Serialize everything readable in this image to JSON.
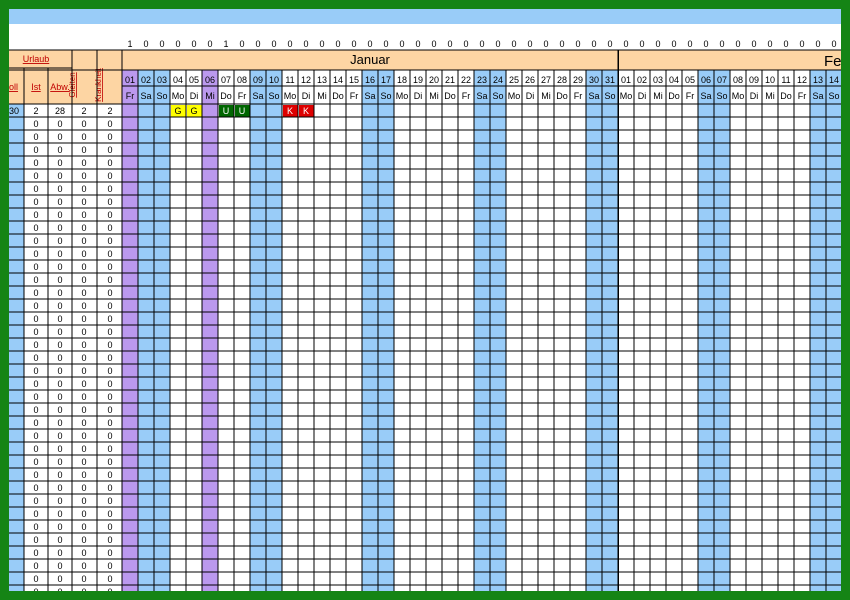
{
  "header": {
    "urlaub": "Urlaub",
    "soll": "oll",
    "ist": "Ist",
    "abw": "Abw.",
    "gleitzeit": "Gleiten",
    "krankheit": "Krankheit"
  },
  "months": [
    {
      "label": "Januar"
    },
    {
      "label": "Fe"
    }
  ],
  "flag_row": [
    "1",
    "0",
    "0",
    "0",
    "0",
    "0",
    "1",
    "0",
    "0",
    "0",
    "0",
    "0",
    "0",
    "0",
    "0",
    "0",
    "0",
    "0",
    "0",
    "0",
    "0",
    "0",
    "0",
    "0",
    "0",
    "0",
    "0",
    "0",
    "0",
    "0",
    "0",
    "0",
    "0",
    "0",
    "0",
    "0",
    "0",
    "0",
    "0",
    "0",
    "0",
    "0",
    "0",
    "0",
    "0"
  ],
  "days": [
    {
      "n": "01",
      "d": "Fr",
      "t": "holiday"
    },
    {
      "n": "02",
      "d": "Sa",
      "t": "weekend"
    },
    {
      "n": "03",
      "d": "So",
      "t": "weekend"
    },
    {
      "n": "04",
      "d": "Mo",
      "t": "work"
    },
    {
      "n": "05",
      "d": "Di",
      "t": "work"
    },
    {
      "n": "06",
      "d": "Mi",
      "t": "holiday"
    },
    {
      "n": "07",
      "d": "Do",
      "t": "work"
    },
    {
      "n": "08",
      "d": "Fr",
      "t": "work"
    },
    {
      "n": "09",
      "d": "Sa",
      "t": "weekend"
    },
    {
      "n": "10",
      "d": "So",
      "t": "weekend"
    },
    {
      "n": "11",
      "d": "Mo",
      "t": "work"
    },
    {
      "n": "12",
      "d": "Di",
      "t": "work"
    },
    {
      "n": "13",
      "d": "Mi",
      "t": "work"
    },
    {
      "n": "14",
      "d": "Do",
      "t": "work"
    },
    {
      "n": "15",
      "d": "Fr",
      "t": "work"
    },
    {
      "n": "16",
      "d": "Sa",
      "t": "weekend"
    },
    {
      "n": "17",
      "d": "So",
      "t": "weekend"
    },
    {
      "n": "18",
      "d": "Mo",
      "t": "work"
    },
    {
      "n": "19",
      "d": "Di",
      "t": "work"
    },
    {
      "n": "20",
      "d": "Mi",
      "t": "work"
    },
    {
      "n": "21",
      "d": "Do",
      "t": "work"
    },
    {
      "n": "22",
      "d": "Fr",
      "t": "work"
    },
    {
      "n": "23",
      "d": "Sa",
      "t": "weekend"
    },
    {
      "n": "24",
      "d": "So",
      "t": "weekend"
    },
    {
      "n": "25",
      "d": "Mo",
      "t": "work"
    },
    {
      "n": "26",
      "d": "Di",
      "t": "work"
    },
    {
      "n": "27",
      "d": "Mi",
      "t": "work"
    },
    {
      "n": "28",
      "d": "Do",
      "t": "work"
    },
    {
      "n": "29",
      "d": "Fr",
      "t": "work"
    },
    {
      "n": "30",
      "d": "Sa",
      "t": "weekend"
    },
    {
      "n": "31",
      "d": "So",
      "t": "weekend"
    },
    {
      "n": "01",
      "d": "Mo",
      "t": "work"
    },
    {
      "n": "02",
      "d": "Di",
      "t": "work"
    },
    {
      "n": "03",
      "d": "Mi",
      "t": "work"
    },
    {
      "n": "04",
      "d": "Do",
      "t": "work"
    },
    {
      "n": "05",
      "d": "Fr",
      "t": "work"
    },
    {
      "n": "06",
      "d": "Sa",
      "t": "weekend"
    },
    {
      "n": "07",
      "d": "So",
      "t": "weekend"
    },
    {
      "n": "08",
      "d": "Mo",
      "t": "work"
    },
    {
      "n": "09",
      "d": "Di",
      "t": "work"
    },
    {
      "n": "10",
      "d": "Mi",
      "t": "work"
    },
    {
      "n": "11",
      "d": "Do",
      "t": "work"
    },
    {
      "n": "12",
      "d": "Fr",
      "t": "work"
    },
    {
      "n": "13",
      "d": "Sa",
      "t": "weekend"
    },
    {
      "n": "14",
      "d": "So",
      "t": "weekend"
    }
  ],
  "rows": [
    {
      "soll": "30",
      "ist": "2",
      "abw": "28",
      "g": "2",
      "k": "2",
      "marks": [
        {
          "day": 3,
          "code": "G",
          "type": "gleit"
        },
        {
          "day": 4,
          "code": "G",
          "type": "gleit"
        },
        {
          "day": 6,
          "code": "U",
          "type": "urlaub"
        },
        {
          "day": 7,
          "code": "U",
          "type": "urlaub"
        },
        {
          "day": 10,
          "code": "K",
          "type": "krank"
        },
        {
          "day": 11,
          "code": "K",
          "type": "krank"
        }
      ]
    },
    {
      "soll": "",
      "ist": "0",
      "abw": "0",
      "g": "0",
      "k": "0",
      "marks": []
    },
    {
      "soll": "",
      "ist": "0",
      "abw": "0",
      "g": "0",
      "k": "0",
      "marks": []
    },
    {
      "soll": "",
      "ist": "0",
      "abw": "0",
      "g": "0",
      "k": "0",
      "marks": []
    },
    {
      "soll": "",
      "ist": "0",
      "abw": "0",
      "g": "0",
      "k": "0",
      "marks": []
    },
    {
      "soll": "",
      "ist": "0",
      "abw": "0",
      "g": "0",
      "k": "0",
      "marks": []
    },
    {
      "soll": "",
      "ist": "0",
      "abw": "0",
      "g": "0",
      "k": "0",
      "marks": []
    },
    {
      "soll": "",
      "ist": "0",
      "abw": "0",
      "g": "0",
      "k": "0",
      "marks": []
    },
    {
      "soll": "",
      "ist": "0",
      "abw": "0",
      "g": "0",
      "k": "0",
      "marks": []
    },
    {
      "soll": "",
      "ist": "0",
      "abw": "0",
      "g": "0",
      "k": "0",
      "marks": []
    },
    {
      "soll": "",
      "ist": "0",
      "abw": "0",
      "g": "0",
      "k": "0",
      "marks": []
    },
    {
      "soll": "",
      "ist": "0",
      "abw": "0",
      "g": "0",
      "k": "0",
      "marks": []
    },
    {
      "soll": "",
      "ist": "0",
      "abw": "0",
      "g": "0",
      "k": "0",
      "marks": []
    },
    {
      "soll": "",
      "ist": "0",
      "abw": "0",
      "g": "0",
      "k": "0",
      "marks": []
    },
    {
      "soll": "",
      "ist": "0",
      "abw": "0",
      "g": "0",
      "k": "0",
      "marks": []
    },
    {
      "soll": "",
      "ist": "0",
      "abw": "0",
      "g": "0",
      "k": "0",
      "marks": []
    },
    {
      "soll": "",
      "ist": "0",
      "abw": "0",
      "g": "0",
      "k": "0",
      "marks": []
    },
    {
      "soll": "",
      "ist": "0",
      "abw": "0",
      "g": "0",
      "k": "0",
      "marks": []
    },
    {
      "soll": "",
      "ist": "0",
      "abw": "0",
      "g": "0",
      "k": "0",
      "marks": []
    },
    {
      "soll": "",
      "ist": "0",
      "abw": "0",
      "g": "0",
      "k": "0",
      "marks": []
    },
    {
      "soll": "",
      "ist": "0",
      "abw": "0",
      "g": "0",
      "k": "0",
      "marks": []
    },
    {
      "soll": "",
      "ist": "0",
      "abw": "0",
      "g": "0",
      "k": "0",
      "marks": []
    },
    {
      "soll": "",
      "ist": "0",
      "abw": "0",
      "g": "0",
      "k": "0",
      "marks": []
    },
    {
      "soll": "",
      "ist": "0",
      "abw": "0",
      "g": "0",
      "k": "0",
      "marks": []
    },
    {
      "soll": "",
      "ist": "0",
      "abw": "0",
      "g": "0",
      "k": "0",
      "marks": []
    },
    {
      "soll": "",
      "ist": "0",
      "abw": "0",
      "g": "0",
      "k": "0",
      "marks": []
    },
    {
      "soll": "",
      "ist": "0",
      "abw": "0",
      "g": "0",
      "k": "0",
      "marks": []
    },
    {
      "soll": "",
      "ist": "0",
      "abw": "0",
      "g": "0",
      "k": "0",
      "marks": []
    },
    {
      "soll": "",
      "ist": "0",
      "abw": "0",
      "g": "0",
      "k": "0",
      "marks": []
    },
    {
      "soll": "",
      "ist": "0",
      "abw": "0",
      "g": "0",
      "k": "0",
      "marks": []
    },
    {
      "soll": "",
      "ist": "0",
      "abw": "0",
      "g": "0",
      "k": "0",
      "marks": []
    },
    {
      "soll": "",
      "ist": "0",
      "abw": "0",
      "g": "0",
      "k": "0",
      "marks": []
    },
    {
      "soll": "",
      "ist": "0",
      "abw": "0",
      "g": "0",
      "k": "0",
      "marks": []
    },
    {
      "soll": "",
      "ist": "0",
      "abw": "0",
      "g": "0",
      "k": "0",
      "marks": []
    },
    {
      "soll": "",
      "ist": "0",
      "abw": "0",
      "g": "0",
      "k": "0",
      "marks": []
    },
    {
      "soll": "",
      "ist": "0",
      "abw": "0",
      "g": "0",
      "k": "0",
      "marks": []
    },
    {
      "soll": "",
      "ist": "0",
      "abw": "0",
      "g": "0",
      "k": "0",
      "marks": []
    },
    {
      "soll": "",
      "ist": "0",
      "abw": "0",
      "g": "0",
      "k": "0",
      "marks": []
    }
  ],
  "colors": {
    "frame": "#158415",
    "top_band": "#99ccf8",
    "header_orange": "#fdd5a3",
    "weekend": "#99ccf8",
    "holiday": "#bb99ee",
    "soll_column": "#99ccf8",
    "gleit": "#ffff00",
    "urlaub": "#006600",
    "krank": "#dd0000",
    "grid_line": "#000000",
    "header_text": "#c00000"
  }
}
